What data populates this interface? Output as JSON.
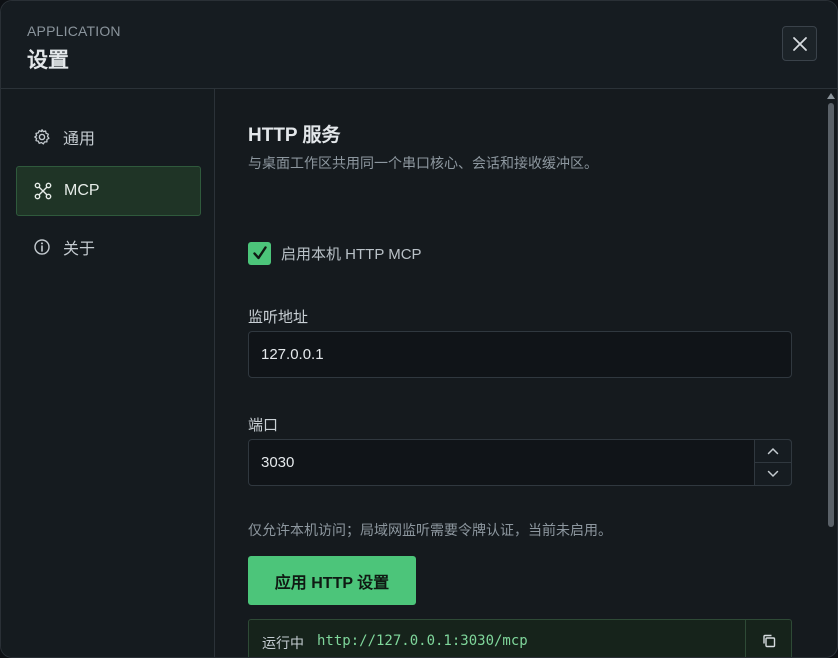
{
  "header": {
    "eyebrow": "APPLICATION",
    "title": "设置"
  },
  "sidebar": {
    "items": [
      {
        "label": "通用",
        "icon": "gear-icon"
      },
      {
        "label": "MCP",
        "icon": "network-icon",
        "active": true
      },
      {
        "label": "关于",
        "icon": "info-icon"
      }
    ]
  },
  "main": {
    "section_title": "HTTP 服务",
    "section_desc": "与桌面工作区共用同一个串口核心、会话和接收缓冲区。",
    "enable_checkbox": {
      "label": "启用本机 HTTP MCP",
      "checked": true
    },
    "listen_address": {
      "label": "监听地址",
      "value": "127.0.0.1"
    },
    "port": {
      "label": "端口",
      "value": "3030"
    },
    "hint": "仅允许本机访问；局域网监听需要令牌认证，当前未启用。",
    "apply_button": "应用 HTTP 设置",
    "status": {
      "label": "运行中",
      "url": "http://127.0.0.1:3030/mcp"
    }
  },
  "colors": {
    "accent": "#4cc57a",
    "background": "#151a1e",
    "active_nav": "#1f3426"
  }
}
